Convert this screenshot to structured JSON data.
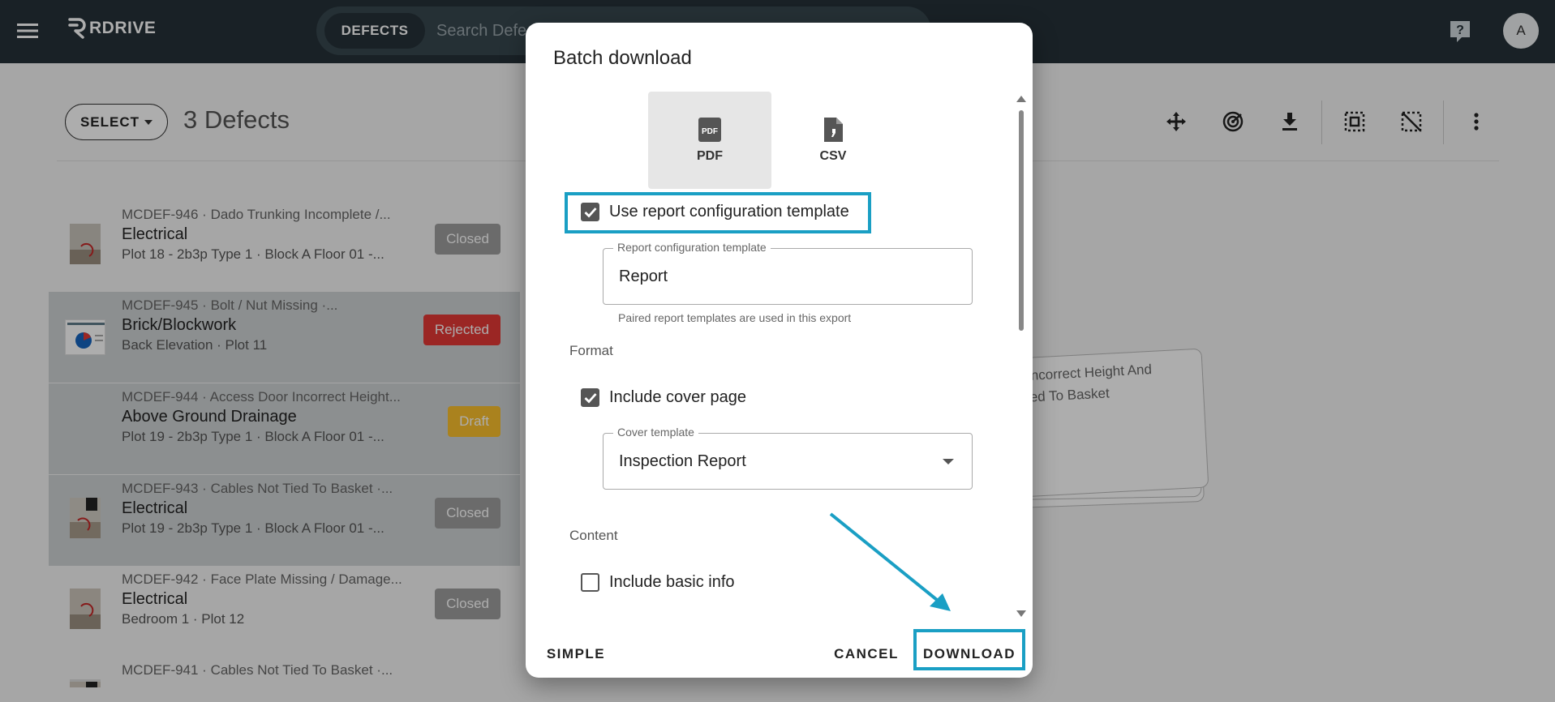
{
  "app": {
    "brand": "RDRIVE",
    "search": {
      "chip": "DEFECTS",
      "placeholder": "Search Defects"
    },
    "avatar_initial": "A",
    "colors": {
      "appbar": "#263238",
      "accent": "#1a9fc4",
      "closed": "#9e9e9e",
      "rejected": "#e53935",
      "draft": "#fbc02d"
    }
  },
  "page": {
    "select_label": "SELECT",
    "title": "3 Defects",
    "toolbar_icons": [
      "move-icon",
      "radar-icon",
      "download-icon",
      "select-all-icon",
      "deselect-icon",
      "more-vert-icon"
    ]
  },
  "defects": [
    {
      "code": "MCDEF-946 · Dado Trunking Incomplete /...",
      "category": "Electrical",
      "location": "Plot 18 - 2b3p Type 1 · Block A Floor 01 -...",
      "status": "Closed",
      "selected": false
    },
    {
      "code": "MCDEF-945 · Bolt / Nut Missing ·...",
      "category": "Brick/Blockwork",
      "location": "Back Elevation · Plot 11",
      "status": "Rejected",
      "selected": true
    },
    {
      "code": "MCDEF-944 · Access Door Incorrect Height...",
      "category": "Above Ground Drainage",
      "location": "Plot 19 - 2b3p Type 1 · Block A Floor 01 -...",
      "status": "Draft",
      "selected": true
    },
    {
      "code": "MCDEF-943 · Cables Not Tied To Basket ·...",
      "category": "Electrical",
      "location": "Plot 19 - 2b3p Type 1 · Block A Floor 01 -...",
      "status": "Closed",
      "selected": true
    },
    {
      "code": "MCDEF-942 · Face Plate Missing / Damage...",
      "category": "Electrical",
      "location": "Bedroom 1 · Plot 12",
      "status": "Closed",
      "selected": false
    },
    {
      "code": "MCDEF-941 · Cables Not Tied To Basket ·...",
      "category": "",
      "location": "",
      "status": "",
      "selected": false
    }
  ],
  "card_stack": {
    "line1": "Incorrect Height And",
    "line2": "ied To Basket"
  },
  "dialog": {
    "title": "Batch download",
    "formats": [
      {
        "label": "PDF",
        "selected": true
      },
      {
        "label": "CSV",
        "selected": false
      }
    ],
    "use_template": {
      "label": "Use report configuration template",
      "checked": true
    },
    "report_template": {
      "label": "Report configuration template",
      "value": "Report",
      "helper": "Paired report templates are used in this export"
    },
    "format_section": "Format",
    "cover_page": {
      "label": "Include cover page",
      "checked": true
    },
    "cover_template": {
      "label": "Cover template",
      "value": "Inspection Report"
    },
    "content_section": "Content",
    "basic_info": {
      "label": "Include basic info",
      "checked": false
    },
    "actions": {
      "simple": "SIMPLE",
      "cancel": "CANCEL",
      "download": "DOWNLOAD"
    }
  }
}
